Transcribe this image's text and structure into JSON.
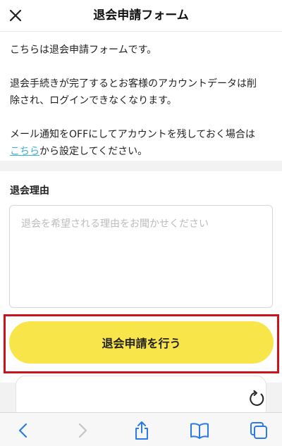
{
  "header": {
    "title": "退会申請フォーム",
    "close_icon": "close-icon"
  },
  "intro": {
    "line1": "こちらは退会申請フォームです。",
    "line2a": "退会手続きが完了するとお客様のアカウントデータは削",
    "line2b": "除され、ログインできなくなります。",
    "line3": "メール通知をOFFにしてアカウントを残しておく場合は",
    "link_text": "こちら",
    "line4_rest": "から設定してください。"
  },
  "reason": {
    "label": "退会理由",
    "placeholder": "退会を希望される理由をお聞かせください"
  },
  "submit": {
    "label": "退会申請を行う",
    "color": "#f7e54a"
  },
  "highlight": {
    "color": "#c8151b"
  },
  "link_color": "#3ab0d6",
  "browser_toolbar": {
    "icons": [
      "back-icon",
      "forward-icon",
      "share-icon",
      "bookmarks-icon",
      "tabs-icon",
      "reload-icon"
    ]
  }
}
